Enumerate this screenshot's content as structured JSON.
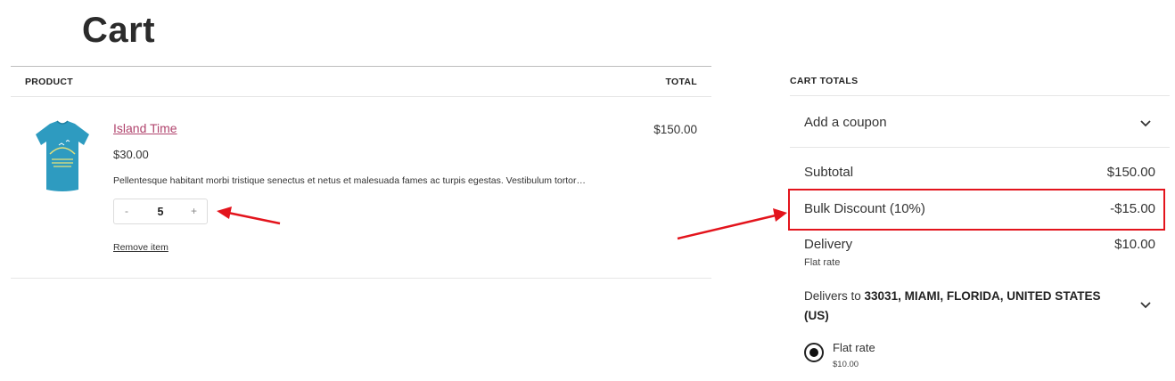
{
  "page": {
    "title": "Cart"
  },
  "cart_table": {
    "headers": {
      "product": "PRODUCT",
      "total": "TOTAL"
    },
    "items": [
      {
        "name": "Island Time",
        "price": "$30.00",
        "description": "Pellentesque habitant morbi tristique senectus et netus et malesuada fames ac turpis egestas. Vestibulum tortor…",
        "quantity": "5",
        "qty_minus": "-",
        "qty_plus": "+",
        "remove_label": "Remove item",
        "line_total": "$150.00",
        "image_icon": "tshirt-image"
      }
    ]
  },
  "cart_totals": {
    "heading": "CART TOTALS",
    "coupon_label": "Add a coupon",
    "subtotal_label": "Subtotal",
    "subtotal_value": "$150.00",
    "discount_label": "Bulk Discount (10%)",
    "discount_value": "-$15.00",
    "delivery_label": "Delivery",
    "delivery_value": "$10.00",
    "delivery_method": "Flat rate",
    "delivers_to_prefix": "Delivers to ",
    "delivers_to_address": "33031, MIAMI, FLORIDA, UNITED STATES (US)",
    "shipping_option_label": "Flat rate",
    "shipping_option_price": "$10.00"
  },
  "colors": {
    "accent_link": "#b1456e",
    "highlight": "#e3141c",
    "tshirt": "#2e9bc0"
  }
}
